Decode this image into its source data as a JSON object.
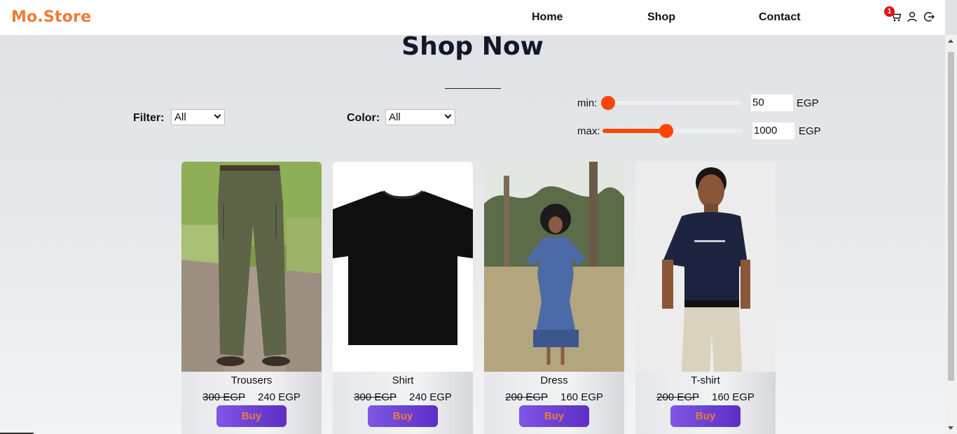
{
  "header": {
    "brand": "Mo.Store",
    "nav": {
      "home": "Home",
      "shop": "Shop",
      "contact": "Contact"
    },
    "cart_count": "1",
    "icons": [
      "cart-icon",
      "user-icon",
      "logout-icon"
    ]
  },
  "main": {
    "title": "Shop Now",
    "filters": {
      "filter_label": "Filter:",
      "filter_value": "All",
      "color_label": "Color:",
      "color_value": "All",
      "min_label": "min:",
      "min_value": "50",
      "max_label": "max:",
      "max_value": "1000",
      "currency": "EGP",
      "min_slider_fraction": 0.0,
      "max_slider_fraction": 0.45
    },
    "products": [
      {
        "name": "Trousers",
        "old_price": "300 EGP",
        "price": "240 EGP",
        "buy_label": "Buy"
      },
      {
        "name": "Shirt",
        "old_price": "300 EGP",
        "price": "240 EGP",
        "buy_label": "Buy"
      },
      {
        "name": "Dress",
        "old_price": "200 EGP",
        "price": "160 EGP",
        "buy_label": "Buy"
      },
      {
        "name": "T-shirt",
        "old_price": "200 EGP",
        "price": "160 EGP",
        "buy_label": "Buy"
      }
    ]
  },
  "colors": {
    "brand": "#ef7b32",
    "accent": "#ff4500",
    "button": "#6a3fd6",
    "badge": "#e01414"
  }
}
